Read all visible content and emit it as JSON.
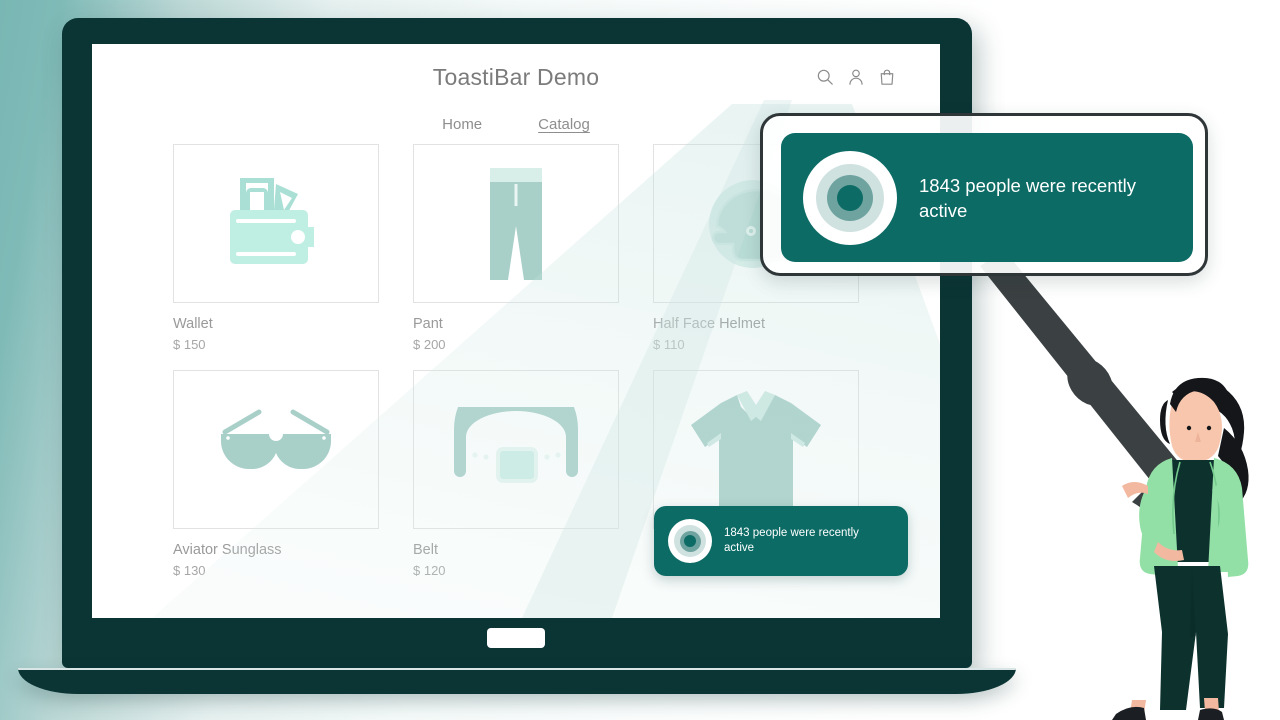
{
  "store": {
    "title": "ToastiBar Demo",
    "nav": [
      {
        "label": "Home",
        "active": false
      },
      {
        "label": "Catalog",
        "active": true
      }
    ],
    "header_icons": [
      {
        "name": "search-icon"
      },
      {
        "name": "user-icon"
      },
      {
        "name": "shopping-bag-icon"
      }
    ],
    "products": [
      {
        "name": "Wallet",
        "price": "$ 150",
        "icon": "wallet-icon"
      },
      {
        "name": "Pant",
        "price": "$ 200",
        "icon": "pant-icon"
      },
      {
        "name": "Half Face Helmet",
        "price": "$ 110",
        "icon": "helmet-icon"
      },
      {
        "name": "Aviator Sunglass",
        "price": "$ 130",
        "icon": "sunglass-icon"
      },
      {
        "name": "Belt",
        "price": "$ 120",
        "icon": "belt-icon"
      },
      {
        "name": "",
        "price": "",
        "icon": "polo-shirt-icon"
      }
    ]
  },
  "toast_small": {
    "message": "1843 people were recently active",
    "icon": "ripple-dot-icon"
  },
  "toast_large": {
    "message": "1843 people were recently active",
    "icon": "ripple-dot-icon"
  },
  "colors": {
    "toast_background": "#0c6b65",
    "toast_text": "#ffffff",
    "laptop_shell": "#0b3434",
    "scene_background_left": "#79b7b4",
    "scene_background_right": "#ffffff",
    "product_icon": "#a9cfc9",
    "jacket_green": "#93e0a6",
    "outfit_dark": "#0d322e",
    "handle_dark": "#3b4042",
    "skin": "#f3b9a0"
  }
}
